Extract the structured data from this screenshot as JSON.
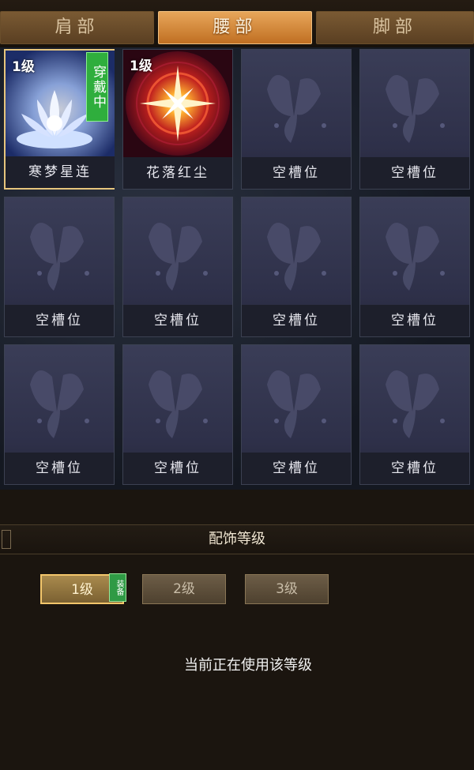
{
  "tabs": [
    {
      "label": "肩部",
      "active": false
    },
    {
      "label": "腰部",
      "active": true
    },
    {
      "label": "脚部",
      "active": false
    }
  ],
  "slots": [
    {
      "name": "寒梦星连",
      "level": "1级",
      "badge": "穿戴中",
      "art": "lotus-icon"
    },
    {
      "name": "花落红尘",
      "level": "1级",
      "badge": "",
      "art": "starburst-icon"
    },
    {
      "name": "空槽位",
      "art": "butterfly-icon"
    },
    {
      "name": "空槽位",
      "art": "butterfly-icon"
    },
    {
      "name": "空槽位",
      "art": "butterfly-icon"
    },
    {
      "name": "空槽位",
      "art": "butterfly-icon"
    },
    {
      "name": "空槽位",
      "art": "butterfly-icon"
    },
    {
      "name": "空槽位",
      "art": "butterfly-icon"
    },
    {
      "name": "空槽位",
      "art": "butterfly-icon"
    },
    {
      "name": "空槽位",
      "art": "butterfly-icon"
    },
    {
      "name": "空槽位",
      "art": "butterfly-icon"
    },
    {
      "name": "空槽位",
      "art": "butterfly-icon"
    }
  ],
  "level_section": {
    "title": "配饰等级",
    "buttons": [
      "1级",
      "2级",
      "3级"
    ],
    "equipped_badge": "装备",
    "status": "当前正在使用该等级"
  },
  "colors": {
    "tab_active": "#d98a38",
    "wear_badge": "#2fae3d",
    "accent": "#f3c66b"
  }
}
